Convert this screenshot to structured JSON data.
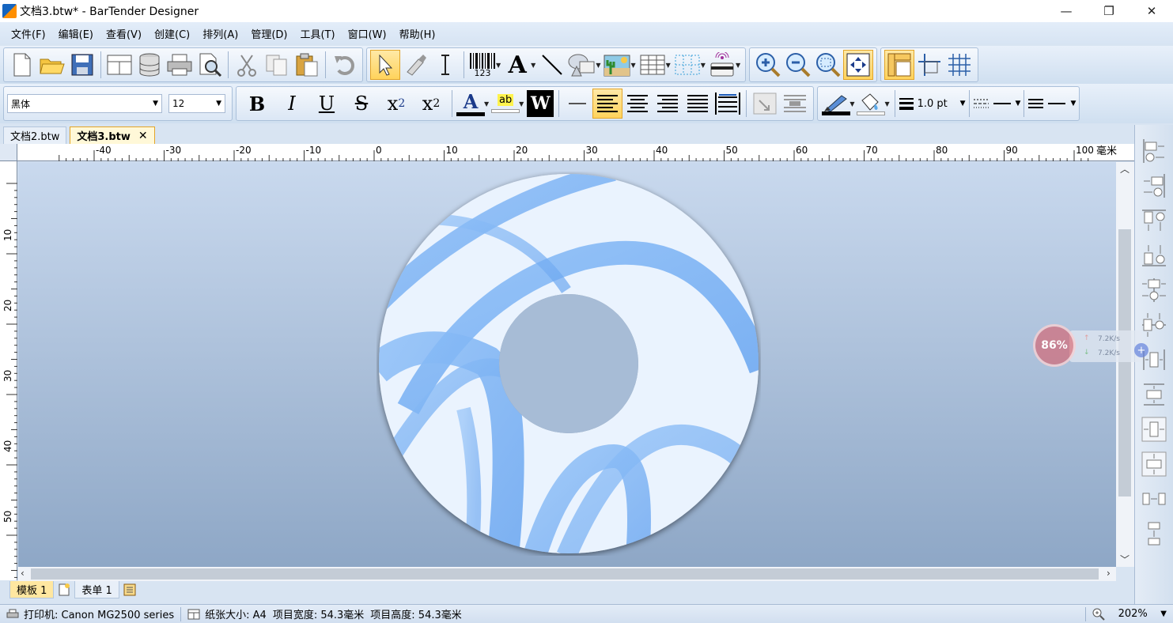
{
  "window": {
    "title": "文档3.btw* - BarTender Designer",
    "controls": [
      "—",
      "❐",
      "✕"
    ]
  },
  "menu": [
    "文件(F)",
    "编辑(E)",
    "查看(V)",
    "创建(C)",
    "排列(A)",
    "管理(D)",
    "工具(T)",
    "窗口(W)",
    "帮助(H)"
  ],
  "toolbar": {
    "font_name": "黑体",
    "font_size": "12",
    "bold": "B",
    "italic": "I",
    "underline": "U",
    "strike": "S",
    "subscript": "x",
    "subscript_digit": "2",
    "superscript": "x",
    "superscript_digit": "2",
    "font_color_glyph": "A",
    "highlight_glyph": "ab",
    "word_glyph": "W",
    "barcode_digits": "123",
    "text_glyph": "A",
    "line_width": "1.0 pt"
  },
  "doc_tabs": [
    {
      "label": "文档2.btw",
      "active": false
    },
    {
      "label": "文档3.btw",
      "active": true,
      "close": "✕"
    }
  ],
  "ruler": {
    "h_labels": [
      "-40",
      "-30",
      "-20",
      "-10",
      "0",
      "10",
      "20",
      "30",
      "40",
      "50",
      "60",
      "70",
      "80",
      "90",
      "100"
    ],
    "unit": "毫米",
    "v_labels": [
      "10",
      "20",
      "30",
      "40",
      "50"
    ]
  },
  "bottom_tabs": {
    "template": "模板 1",
    "form": "表单 1"
  },
  "status": {
    "printer": "打印机: Canon MG2500 series",
    "paper": "纸张大小: A4",
    "width": "项目宽度: 54.3毫米",
    "height": "项目高度: 54.3毫米",
    "zoom": "202%"
  },
  "net_widget": {
    "percent": "86%",
    "up": "7.2K/s",
    "down": "7.2K/s",
    "up_arrow": "↑",
    "down_arrow": "↓",
    "plus": "+"
  },
  "colors": {
    "accent": "#ffd35c",
    "canvas_top": "#c9d9ee",
    "canvas_bottom": "#8ea7c6",
    "swirl": "#7fb2f5"
  }
}
